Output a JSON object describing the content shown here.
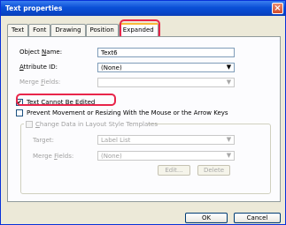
{
  "window": {
    "title": "Text properties",
    "close_glyph": "×"
  },
  "tabs": [
    "Text",
    "Font",
    "Drawing",
    "Position",
    "Expanded"
  ],
  "fields": {
    "object_name": {
      "label_pre": "Object ",
      "label_u": "N",
      "label_post": "ame:",
      "value": "Text6"
    },
    "attribute_id": {
      "label_pre": "",
      "label_u": "A",
      "label_post": "ttribute ID:",
      "value": "(None)"
    },
    "merge_fields": {
      "label_pre": "Merge ",
      "label_u": "F",
      "label_post": "ields:",
      "value": ""
    }
  },
  "checkboxes": {
    "text_cannot_be_edited": {
      "label_u": "T",
      "label_post": "ext Cannot Be Edited",
      "checked": true
    },
    "prevent_movement": {
      "label": "Prevent Movement or Resizing With the Mouse or the Arrow Keys",
      "checked": false
    }
  },
  "group": {
    "change_data_label_pre": "",
    "change_data_label_u": "C",
    "change_data_label_post": "hange Data in Layout Style Templates",
    "target_label": "Target:",
    "target_value": "Label List",
    "merge_fields_label_pre": "Merge ",
    "merge_fields_label_u": "F",
    "merge_fields_label_post": "ields:",
    "merge_fields_value": "(None)",
    "edit_button": "Edit...",
    "delete_button": "Delete"
  },
  "buttons": {
    "ok": "OK",
    "cancel": "Cancel"
  },
  "icons": {
    "checkmark": "✔",
    "dropdown": "▼"
  },
  "colors": {
    "highlight": "#e8254a",
    "titlebar": "#0a4fd6"
  }
}
